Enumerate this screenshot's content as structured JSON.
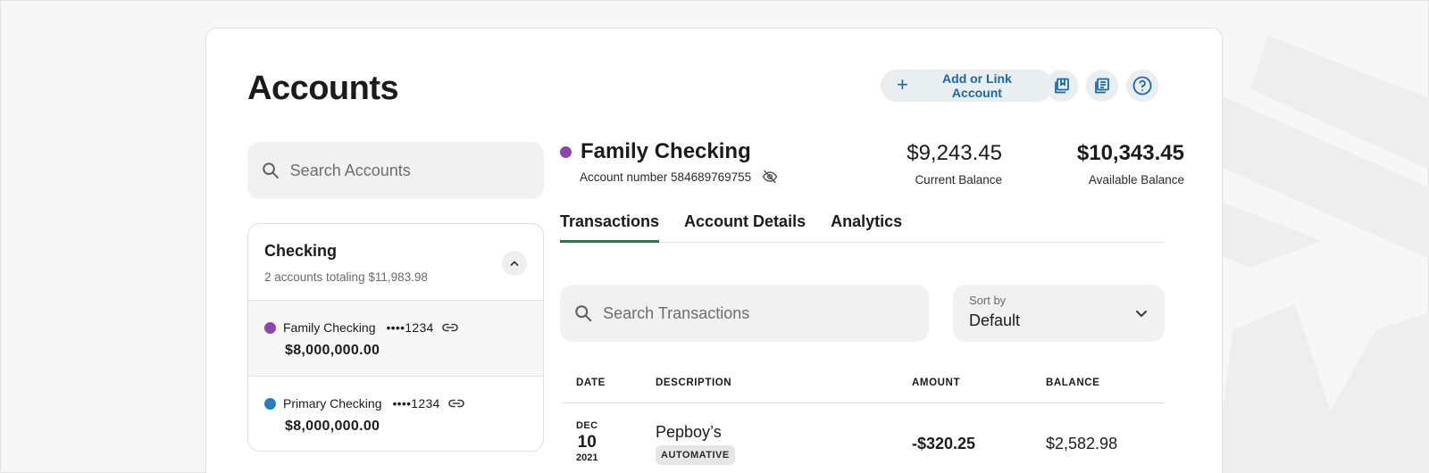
{
  "page": {
    "title": "Accounts"
  },
  "toolbar": {
    "add_label": "Add or Link Account",
    "icons": [
      "bookmark-icon",
      "statements-icon",
      "help-icon"
    ],
    "accent_color": "#1a67a6"
  },
  "sidebar": {
    "search_placeholder": "Search Accounts",
    "group": {
      "title": "Checking",
      "summary": "2 accounts totaling $11,983.98",
      "expanded": true,
      "accounts": [
        {
          "name": "Family Checking",
          "mask": "••••1234",
          "amount": "$8,000,000.00",
          "color": "#8e44ad",
          "selected": true
        },
        {
          "name": "Primary Checking",
          "mask": "••••1234",
          "amount": "$8,000,000.00",
          "color": "#2b7bbf",
          "selected": false
        }
      ]
    }
  },
  "account": {
    "name": "Family Checking",
    "color": "#8e44ad",
    "number_label": "Account number 584689769755",
    "current_balance": "$9,243.45",
    "current_balance_label": "Current Balance",
    "available_balance": "$10,343.45",
    "available_balance_label": "Available Balance"
  },
  "tabs": [
    {
      "label": "Transactions",
      "active": true
    },
    {
      "label": "Account Details",
      "active": false
    },
    {
      "label": "Analytics",
      "active": false
    }
  ],
  "transactions": {
    "search_placeholder": "Search Transactions",
    "sort_label": "Sort by",
    "sort_value": "Default",
    "columns": [
      "DATE",
      "DESCRIPTION",
      "AMOUNT",
      "BALANCE"
    ],
    "rows": [
      {
        "month": "DEC",
        "day": "10",
        "year": "2021",
        "description": "Pepboy’s",
        "category": "AUTOMATIVE",
        "amount": "-$320.25",
        "balance": "$2,582.98"
      }
    ]
  }
}
